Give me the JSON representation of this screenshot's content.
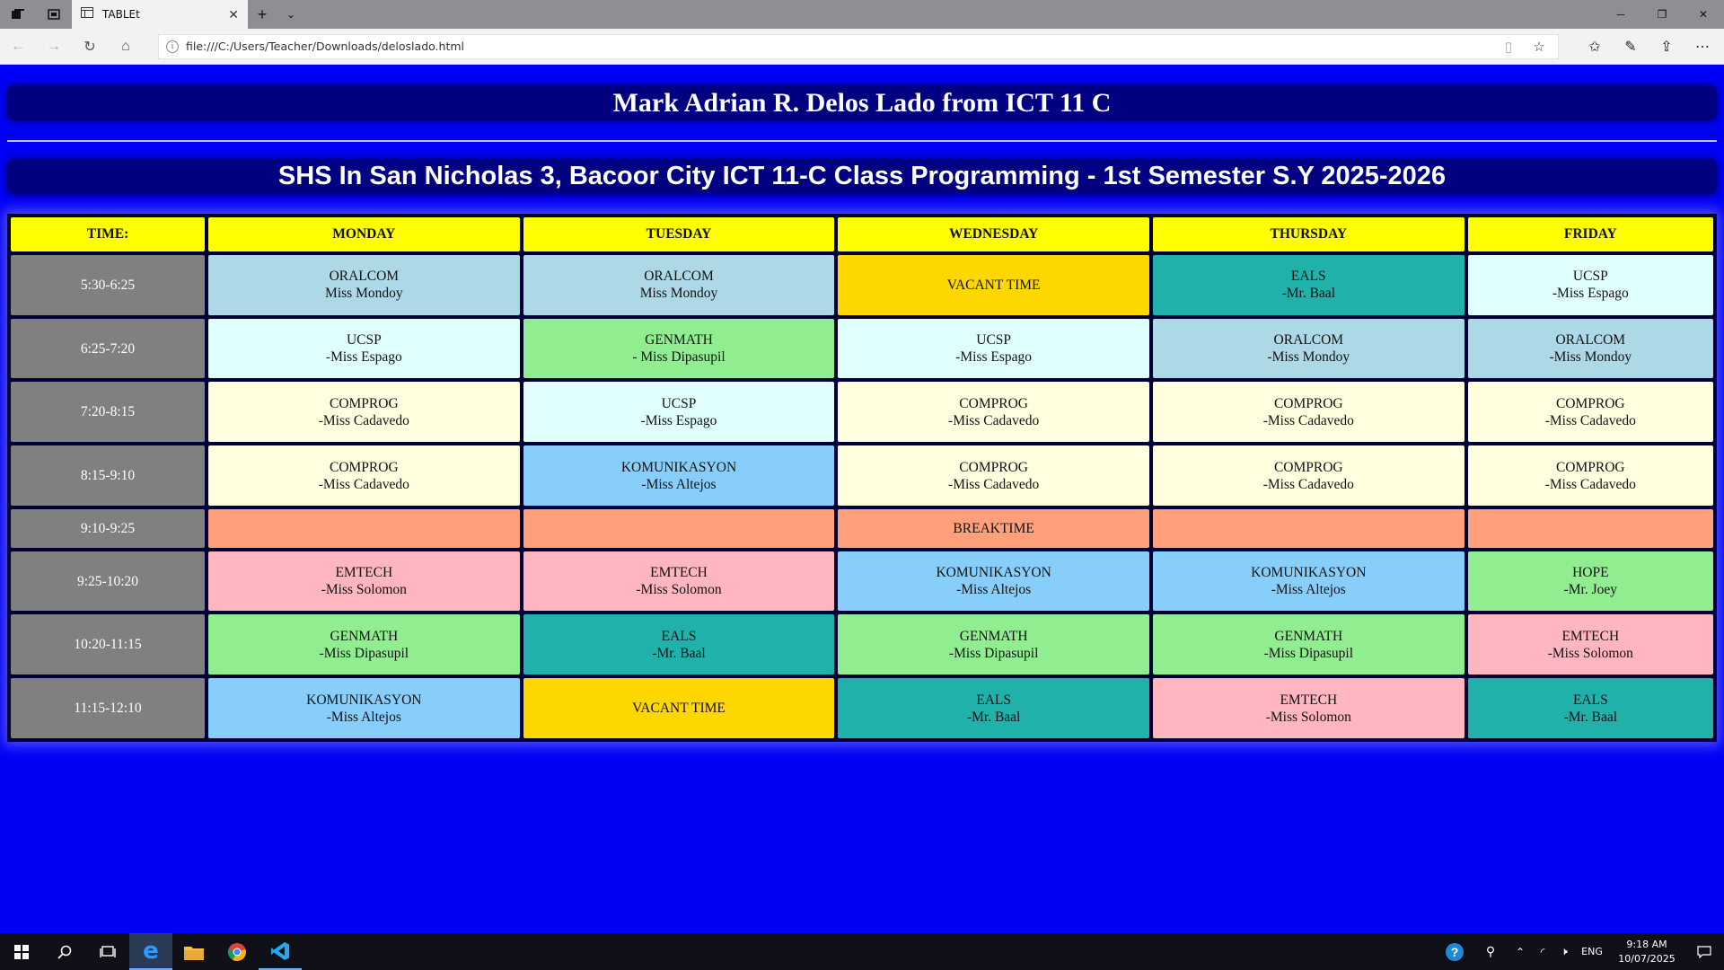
{
  "browser": {
    "tab_title": "TABLEt",
    "url": "file:///C:/Users/Teacher/Downloads/deloslado.html"
  },
  "page": {
    "heading": "Mark Adrian R. Delos Lado from ICT 11 C",
    "subheading": "SHS In San Nicholas 3, Bacoor City ICT 11-C Class Programming - 1st Semester S.Y 2025-2026"
  },
  "schedule": {
    "headers": [
      "TIME:",
      "MONDAY",
      "TUESDAY",
      "WEDNESDAY",
      "THURSDAY",
      "FRIDAY"
    ],
    "rows": [
      {
        "time": "5:30-6:25",
        "cells": [
          {
            "subject": "ORALCOM",
            "teacher": "Miss Mondoy",
            "color": "#add8e6"
          },
          {
            "subject": "ORALCOM",
            "teacher": "Miss Mondoy",
            "color": "#add8e6"
          },
          {
            "subject": "VACANT TIME",
            "teacher": "",
            "color": "#ffd700"
          },
          {
            "subject": "EALS",
            "teacher": "-Mr. Baal",
            "color": "#20b2aa"
          },
          {
            "subject": "UCSP",
            "teacher": "-Miss Espago",
            "color": "#e0ffff"
          }
        ]
      },
      {
        "time": "6:25-7:20",
        "cells": [
          {
            "subject": "UCSP",
            "teacher": "-Miss Espago",
            "color": "#e0ffff"
          },
          {
            "subject": "GENMATH",
            "teacher": "- Miss Dipasupil",
            "color": "#90ee90"
          },
          {
            "subject": "UCSP",
            "teacher": "-Miss Espago",
            "color": "#e0ffff"
          },
          {
            "subject": "ORALCOM",
            "teacher": "-Miss Mondoy",
            "color": "#add8e6"
          },
          {
            "subject": "ORALCOM",
            "teacher": "-Miss Mondoy",
            "color": "#add8e6"
          }
        ]
      },
      {
        "time": "7:20-8:15",
        "cells": [
          {
            "subject": "COMPROG",
            "teacher": "-Miss Cadavedo",
            "color": "#ffffe0"
          },
          {
            "subject": "UCSP",
            "teacher": "-Miss Espago",
            "color": "#e0ffff"
          },
          {
            "subject": "COMPROG",
            "teacher": "-Miss Cadavedo",
            "color": "#ffffe0"
          },
          {
            "subject": "COMPROG",
            "teacher": "-Miss Cadavedo",
            "color": "#ffffe0"
          },
          {
            "subject": "COMPROG",
            "teacher": "-Miss Cadavedo",
            "color": "#ffffe0"
          }
        ]
      },
      {
        "time": "8:15-9:10",
        "cells": [
          {
            "subject": "COMPROG",
            "teacher": "-Miss Cadavedo",
            "color": "#ffffe0"
          },
          {
            "subject": "KOMUNIKASYON",
            "teacher": "-Miss Altejos",
            "color": "#87cefa"
          },
          {
            "subject": "COMPROG",
            "teacher": "-Miss Cadavedo",
            "color": "#ffffe0"
          },
          {
            "subject": "COMPROG",
            "teacher": "-Miss Cadavedo",
            "color": "#ffffe0"
          },
          {
            "subject": "COMPROG",
            "teacher": "-Miss Cadavedo",
            "color": "#ffffe0"
          }
        ]
      },
      {
        "time": "9:10-9:25",
        "short": true,
        "cells": [
          {
            "subject": "",
            "teacher": "",
            "color": "#ffa07a"
          },
          {
            "subject": "",
            "teacher": "",
            "color": "#ffa07a"
          },
          {
            "subject": "BREAKTIME",
            "teacher": "",
            "color": "#ffa07a"
          },
          {
            "subject": "",
            "teacher": "",
            "color": "#ffa07a"
          },
          {
            "subject": "",
            "teacher": "",
            "color": "#ffa07a"
          }
        ]
      },
      {
        "time": "9:25-10:20",
        "cells": [
          {
            "subject": "EMTECH",
            "teacher": "-Miss Solomon",
            "color": "#ffb6c1"
          },
          {
            "subject": "EMTECH",
            "teacher": "-Miss Solomon",
            "color": "#ffb6c1"
          },
          {
            "subject": "KOMUNIKASYON",
            "teacher": "-Miss Altejos",
            "color": "#87cefa"
          },
          {
            "subject": "KOMUNIKASYON",
            "teacher": "-Miss Altejos",
            "color": "#87cefa"
          },
          {
            "subject": "HOPE",
            "teacher": "-Mr. Joey",
            "color": "#90ee90"
          }
        ]
      },
      {
        "time": "10:20-11:15",
        "cells": [
          {
            "subject": "GENMATH",
            "teacher": "-Miss Dipasupil",
            "color": "#90ee90"
          },
          {
            "subject": "EALS",
            "teacher": "-Mr. Baal",
            "color": "#20b2aa"
          },
          {
            "subject": "GENMATH",
            "teacher": "-Miss Dipasupil",
            "color": "#90ee90"
          },
          {
            "subject": "GENMATH",
            "teacher": "-Miss Dipasupil",
            "color": "#90ee90"
          },
          {
            "subject": "EMTECH",
            "teacher": "-Miss Solomon",
            "color": "#ffb6c1"
          }
        ]
      },
      {
        "time": "11:15-12:10",
        "cells": [
          {
            "subject": "KOMUNIKASYON",
            "teacher": "-Miss Altejos",
            "color": "#87cefa"
          },
          {
            "subject": "VACANT TIME",
            "teacher": "",
            "color": "#ffd700"
          },
          {
            "subject": "EALS",
            "teacher": "-Mr. Baal",
            "color": "#20b2aa"
          },
          {
            "subject": "EMTECH",
            "teacher": "-Miss Solomon",
            "color": "#ffb6c1"
          },
          {
            "subject": "EALS",
            "teacher": "-Mr. Baal",
            "color": "#20b2aa"
          }
        ]
      }
    ]
  },
  "taskbar": {
    "language": "ENG",
    "time": "9:18 AM",
    "date": "10/07/2025",
    "pinned_icons": [
      "windows-start-icon",
      "search-icon",
      "task-view-icon",
      "edge-icon",
      "file-explorer-icon",
      "chrome-icon",
      "vscode-icon"
    ]
  },
  "colors": {
    "page_background": "#0000f5",
    "banner_background": "#000080",
    "header_cell": "#ffff00",
    "time_cell": "#808080"
  }
}
